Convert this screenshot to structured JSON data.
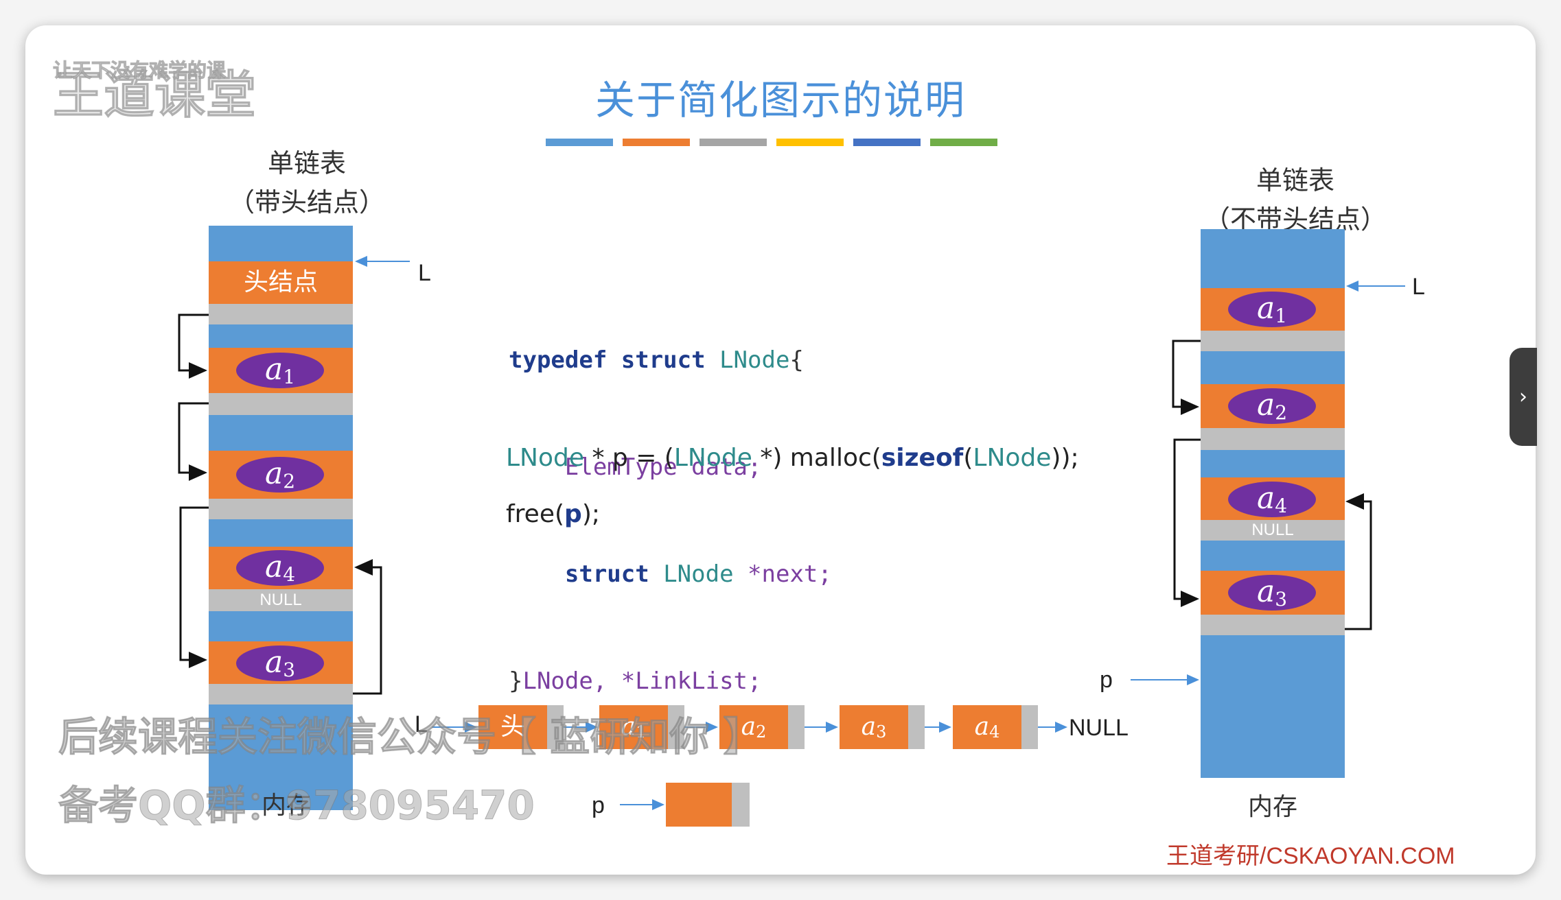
{
  "title": "关于简化图示的说明",
  "color_bars": [
    "#5b9bd5",
    "#ed7d31",
    "#a5a5a5",
    "#ffc000",
    "#4472c4",
    "#70ad47"
  ],
  "left_diagram": {
    "title_line1": "单链表",
    "title_line2": "（带头结点）",
    "head_node_label": "头结点",
    "pointer_label": "L",
    "elements": [
      "a",
      "a",
      "a",
      "a"
    ],
    "subscripts": [
      "1",
      "2",
      "4",
      "3"
    ],
    "null_label": "NULL",
    "memory_label": "内存"
  },
  "right_diagram": {
    "title_line1": "单链表",
    "title_line2": "（不带头结点）",
    "pointer_label": "L",
    "elements": [
      "a",
      "a",
      "a",
      "a"
    ],
    "subscripts": [
      "1",
      "2",
      "4",
      "3"
    ],
    "null_label": "NULL",
    "p_label": "p",
    "memory_label": "内存"
  },
  "code": {
    "line1": {
      "kw": "typedef struct",
      "name": "LNode",
      "brace": "{"
    },
    "line2": {
      "type": "ElemType",
      "rest": "data;"
    },
    "line3": {
      "kw": "struct",
      "type": "LNode",
      "rest": "*next;"
    },
    "line4": {
      "brace": "}",
      "type": "LNode",
      "rest": ", *LinkList;"
    },
    "malloc_line": {
      "t1": "LNode",
      "p1": " * p = (",
      "t2": "LNode",
      "p2": " *) malloc(",
      "kw": "sizeof",
      "p3": "(",
      "t3": "LNode",
      "p4": "));"
    },
    "free_line": {
      "p1": "free(",
      "kw": "p",
      "p2": ");"
    }
  },
  "chain": {
    "head_pointer": "L",
    "head_node": "头",
    "elements": [
      "a",
      "a",
      "a",
      "a"
    ],
    "subscripts": [
      "1",
      "2",
      "3",
      "4"
    ],
    "null_label": "NULL",
    "p_label": "p"
  },
  "watermark": {
    "logo": "王道课堂",
    "logo_sub": "让天下没有难学的课",
    "line1": "后续课程关注微信公众号【 蓝研知你 】",
    "line2": "备考QQ群：978095470"
  },
  "brand": "王道考研/CSKAOYAN.COM",
  "side_tab_icon": "chevron-right-icon",
  "side_tab_glyph": "›"
}
